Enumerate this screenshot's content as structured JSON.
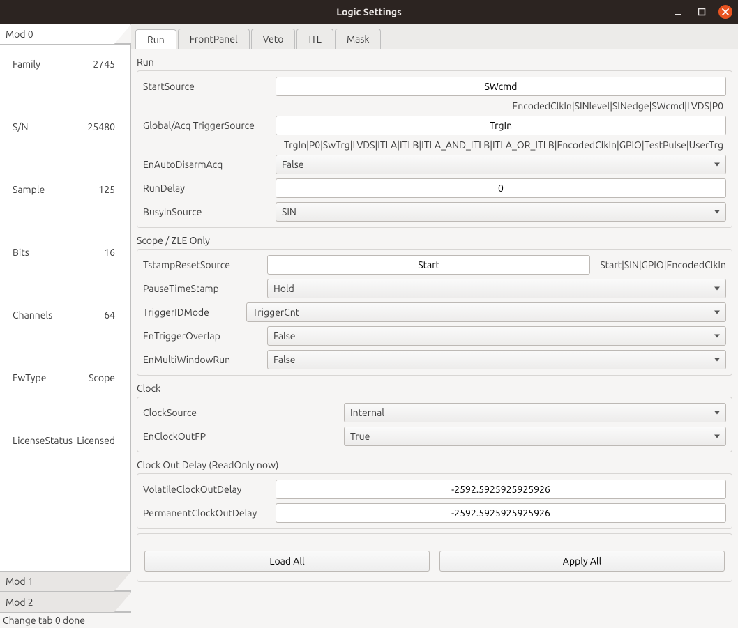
{
  "window": {
    "title": "Logic Settings"
  },
  "modules": {
    "tabs": [
      {
        "label": "Mod 0"
      },
      {
        "label": "Mod 1"
      },
      {
        "label": "Mod 2"
      }
    ],
    "active": 0,
    "info": {
      "family": {
        "label": "Family",
        "value": "2745"
      },
      "sn": {
        "label": "S/N",
        "value": "25480"
      },
      "sample": {
        "label": "Sample",
        "value": "125"
      },
      "bits": {
        "label": "Bits",
        "value": "16"
      },
      "channels": {
        "label": "Channels",
        "value": "64"
      },
      "fwtype": {
        "label": "FwType",
        "value": "Scope"
      },
      "license": {
        "label": "LicenseStatus",
        "value": "Licensed"
      }
    }
  },
  "tabs": {
    "items": [
      {
        "label": "Run"
      },
      {
        "label": "FrontPanel"
      },
      {
        "label": "Veto"
      },
      {
        "label": "ITL"
      },
      {
        "label": "Mask"
      }
    ],
    "active": 0
  },
  "run": {
    "title": "Run",
    "start_source": {
      "label": "StartSource",
      "value": "SWcmd",
      "hint": "EncodedClkIn|SINlevel|SINedge|SWcmd|LVDS|P0"
    },
    "global_trigger": {
      "label": "Global/Acq TriggerSource",
      "value": "TrgIn",
      "hint": "TrgIn|P0|SwTrg|LVDS|ITLA|ITLB|ITLA_AND_ITLB|ITLA_OR_ITLB|EncodedClkIn|GPIO|TestPulse|UserTrg"
    },
    "en_auto_disarm": {
      "label": "EnAutoDisarmAcq",
      "value": "False"
    },
    "run_delay": {
      "label": "RunDelay",
      "value": "0"
    },
    "busy_in_source": {
      "label": "BusyInSource",
      "value": "SIN"
    }
  },
  "scope": {
    "title": "Scope / ZLE Only",
    "tstamp_reset": {
      "label": "TstampResetSource",
      "value": "Start",
      "hint": "Start|SIN|GPIO|EncodedClkIn"
    },
    "pause_timestamp": {
      "label": "PauseTimeStamp",
      "value": "Hold"
    },
    "trigger_id_mode": {
      "label": "TriggerIDMode",
      "value": "TriggerCnt"
    },
    "en_trigger_overlap": {
      "label": "EnTriggerOverlap",
      "value": "False"
    },
    "en_multi_window": {
      "label": "EnMultiWindowRun",
      "value": "False"
    }
  },
  "clock": {
    "title": "Clock",
    "clock_source": {
      "label": "ClockSource",
      "value": "Internal"
    },
    "en_clock_out_fp": {
      "label": "EnClockOutFP",
      "value": "True"
    }
  },
  "clock_out": {
    "title": "Clock Out Delay (ReadOnly now)",
    "volatile": {
      "label": "VolatileClockOutDelay",
      "value": "-2592.5925925925926"
    },
    "permanent": {
      "label": "PermanentClockOutDelay",
      "value": "-2592.5925925925926"
    }
  },
  "buttons": {
    "load": "Load All",
    "apply": "Apply All"
  },
  "status": "Change tab 0 done"
}
